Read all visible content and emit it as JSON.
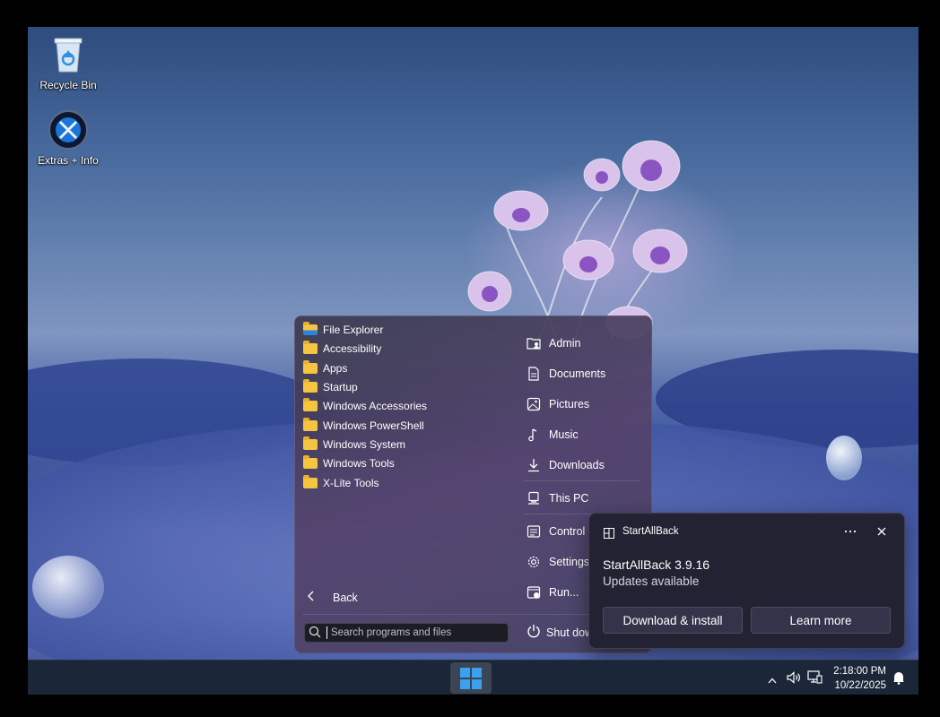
{
  "desktop": {
    "icons": [
      {
        "label": "Recycle Bin",
        "icon": "recycle-bin-icon"
      },
      {
        "label": "Extras + Info",
        "icon": "extras-info-icon"
      }
    ]
  },
  "start_menu": {
    "programs": [
      {
        "label": "File Explorer",
        "icon": "file-explorer-icon"
      },
      {
        "label": "Accessibility",
        "icon": "folder-icon"
      },
      {
        "label": "Apps",
        "icon": "folder-icon"
      },
      {
        "label": "Startup",
        "icon": "folder-icon"
      },
      {
        "label": "Windows Accessories",
        "icon": "folder-icon"
      },
      {
        "label": "Windows PowerShell",
        "icon": "folder-icon"
      },
      {
        "label": "Windows System",
        "icon": "folder-icon"
      },
      {
        "label": "Windows Tools",
        "icon": "folder-icon"
      },
      {
        "label": "X-Lite Tools",
        "icon": "folder-icon"
      }
    ],
    "places": [
      {
        "label": "Admin",
        "icon": "user-folder-icon"
      },
      {
        "label": "Documents",
        "icon": "document-icon"
      },
      {
        "label": "Pictures",
        "icon": "picture-icon"
      },
      {
        "label": "Music",
        "icon": "music-note-icon"
      },
      {
        "label": "Downloads",
        "icon": "download-icon"
      },
      {
        "label": "This PC",
        "icon": "computer-icon"
      },
      {
        "label": "Control",
        "icon": "control-panel-icon"
      },
      {
        "label": "Settings",
        "icon": "gear-icon"
      },
      {
        "label": "Run...",
        "icon": "run-icon"
      }
    ],
    "back_label": "Back",
    "search_placeholder": "Search programs and files",
    "shutdown_label": "Shut dow"
  },
  "notification": {
    "app_name": "StartAllBack",
    "title": "StartAllBack 3.9.16",
    "message": "Updates available",
    "primary_button": "Download & install",
    "secondary_button": "Learn more"
  },
  "taskbar": {
    "time": "2:18:00 PM",
    "date": "10/22/2025"
  },
  "colors": {
    "folder": "#f5c542",
    "accent_blue": "#3aa0f0",
    "taskbar": "#1b2738",
    "toast_bg": "#222232"
  }
}
